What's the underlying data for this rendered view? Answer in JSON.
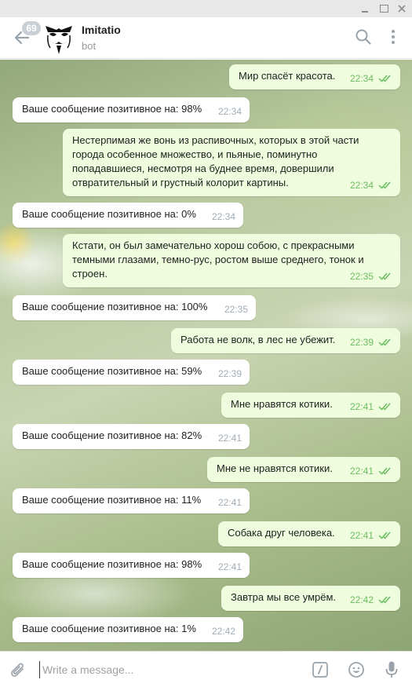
{
  "window": {
    "controls": [
      "minimize",
      "maximize",
      "close"
    ]
  },
  "header": {
    "back_icon": "arrow-left-icon",
    "unread_count": "69",
    "title": "Imitatio",
    "status": "bot",
    "search_icon": "search-icon",
    "menu_icon": "more-vertical-icon"
  },
  "colors": {
    "outgoing_bubble": "#effdde",
    "incoming_bubble": "#ffffff",
    "outgoing_time": "#6cbd61",
    "incoming_time": "#a0acb6",
    "badge": "#c9cfd5"
  },
  "messages": [
    {
      "direction": "out",
      "text": "Мир спасёт красота.",
      "time": "22:34",
      "read": true
    },
    {
      "direction": "in",
      "text": "Ваше сообщение позитивное на: 98%",
      "time": "22:34"
    },
    {
      "direction": "out",
      "text": "Нестерпимая же вонь из распивочных, которых в этой части города особенное множество, и пьяные, поминутно попадавшиеся, несмотря на буднее время, довершили отвратительный и грустный колорит картины.",
      "time": "22:34",
      "read": true
    },
    {
      "direction": "in",
      "text": "Ваше сообщение позитивное на: 0%",
      "time": "22:34"
    },
    {
      "direction": "out",
      "text": "Кстати, он был замечательно хорош собою, с прекрасными темными глазами, темно-рус, ростом выше среднего, тонок и строен.",
      "time": "22:35",
      "read": true
    },
    {
      "direction": "in",
      "text": "Ваше сообщение позитивное на: 100%",
      "time": "22:35"
    },
    {
      "direction": "out",
      "text": "Работа не волк, в лес не убежит.",
      "time": "22:39",
      "read": true
    },
    {
      "direction": "in",
      "text": "Ваше сообщение позитивное на: 59%",
      "time": "22:39"
    },
    {
      "direction": "out",
      "text": "Мне нравятся котики.",
      "time": "22:41",
      "read": true
    },
    {
      "direction": "in",
      "text": "Ваше сообщение позитивное на: 82%",
      "time": "22:41"
    },
    {
      "direction": "out",
      "text": "Мне не нравятся котики.",
      "time": "22:41",
      "read": true
    },
    {
      "direction": "in",
      "text": "Ваше сообщение позитивное на: 11%",
      "time": "22:41"
    },
    {
      "direction": "out",
      "text": "Собака друг человека.",
      "time": "22:41",
      "read": true
    },
    {
      "direction": "in",
      "text": "Ваше сообщение позитивное на: 98%",
      "time": "22:41"
    },
    {
      "direction": "out",
      "text": "Завтра мы все умрём.",
      "time": "22:42",
      "read": true
    },
    {
      "direction": "in",
      "text": "Ваше сообщение позитивное на: 1%",
      "time": "22:42"
    }
  ],
  "composer": {
    "placeholder": "Write a message...",
    "value": "",
    "attach_icon": "paperclip-icon",
    "command_icon": "slash-command-icon",
    "emoji_icon": "smiley-icon",
    "mic_icon": "microphone-icon"
  }
}
